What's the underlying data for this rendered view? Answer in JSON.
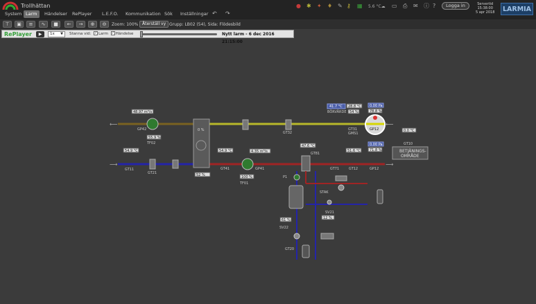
{
  "app": {
    "title": "Trollhättan"
  },
  "menu": {
    "items": [
      "System",
      "Larm",
      "Händelser",
      "RePlayer",
      "L.E.F.O.",
      "Kommunikation",
      "Sök",
      "Inställningar"
    ],
    "active": "Larm"
  },
  "header": {
    "login": "Logga in",
    "server_label": "Servertid",
    "server_time": "15:38:00",
    "server_date": "5 apr 2018",
    "brand": "LARMIA"
  },
  "toolbar": {
    "zoom": "Zoom: 100%",
    "fixed_view": "Återställ vy",
    "group": "Grupp: LB02 (54), Sida: Flödesbild"
  },
  "replayer": {
    "title": "RePlayer",
    "speed": "1x",
    "stop_label": "Stanna vid:",
    "stop_larm": "Larm",
    "stop_events": "Händelse",
    "new_alarm": "Nytt larm - 6 dec 2016 21:15:00"
  },
  "diagram": {
    "gp42_val": "48.97 m³/s",
    "gp42_label": "GP42",
    "gp42_pct": "55.9 %",
    "tf02_label": "TF02",
    "gt11_val": "54.9 °C",
    "gt11_label": "GT11",
    "gt21_label": "GT21",
    "hx_pct": "0 %",
    "hx_pct2": "52 %",
    "gt41_val": "54.9 °C",
    "gt41_label": "GT41",
    "gp41_val": "4.35 m³/s",
    "gp41_label": "GP41",
    "gp41_pct": "100 %",
    "tf01_label": "TF01",
    "gt32_label": "GT32",
    "sp_val": "41.7 °C",
    "sp_label": "BÖRVÄRDE",
    "gt31_val": "28.8 °C",
    "gt31_label": "GT31",
    "gt31_label2": "GMS1",
    "gt31_pct": "54 %",
    "gp12_top": "0.00 Pa",
    "gp12_val": "78.8 %",
    "gp12_label": "GP12",
    "gp12b_top": "0.00 Pa",
    "gp12b_val": "71.8 %",
    "gp12b_label": "GP12",
    "gt12_val": "51.6 °C",
    "gt12_label": "GT12",
    "gt71_label": "GT71",
    "gt81_val": "47.6 °C",
    "gt81_label": "GT81",
    "gt10_val": "0.0 °C",
    "gt10_label": "GT10",
    "service_line1": "BETJÄNINGS-",
    "service_line2": "OMRÅDE",
    "p1_label": "P1",
    "gt_left_val": "61 %",
    "sv22_label": "SV22",
    "sv21_label": "SV21",
    "sv21_pct": "12 %",
    "stak_label": "STAK",
    "gt_ret_label": "GT20"
  }
}
